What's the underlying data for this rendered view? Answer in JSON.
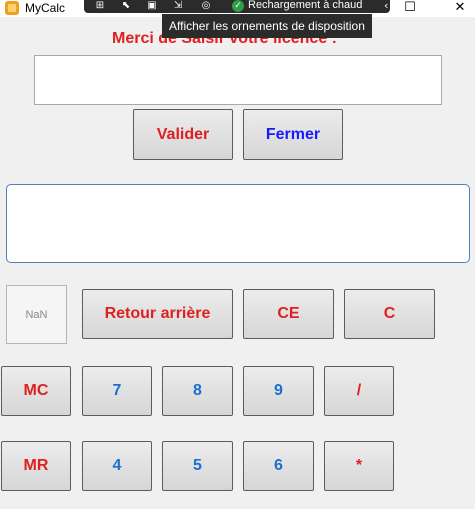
{
  "window": {
    "app_title": "MyCalc",
    "hot_reload_label": "Rechargement à chaud",
    "tooltip": "Afficher les ornements de disposition",
    "close_glyph": "✕",
    "maximize_glyph": "☐"
  },
  "licence": {
    "title": "Merci de Saisir votre licence :",
    "input_value": "",
    "validate_label": "Valider",
    "close_label": "Fermer"
  },
  "calculator": {
    "display_value": "",
    "status_text": "NaN",
    "rows": [
      [
        "Retour arrière",
        "CE",
        "C"
      ],
      [
        "MC",
        "7",
        "8",
        "9",
        "/"
      ],
      [
        "MR",
        "4",
        "5",
        "6",
        "*"
      ]
    ]
  },
  "colors": {
    "label_red": "#e02020",
    "label_blue": "#1a1aff",
    "digit_blue": "#1d6fd0",
    "display_border": "#4f80c0"
  }
}
